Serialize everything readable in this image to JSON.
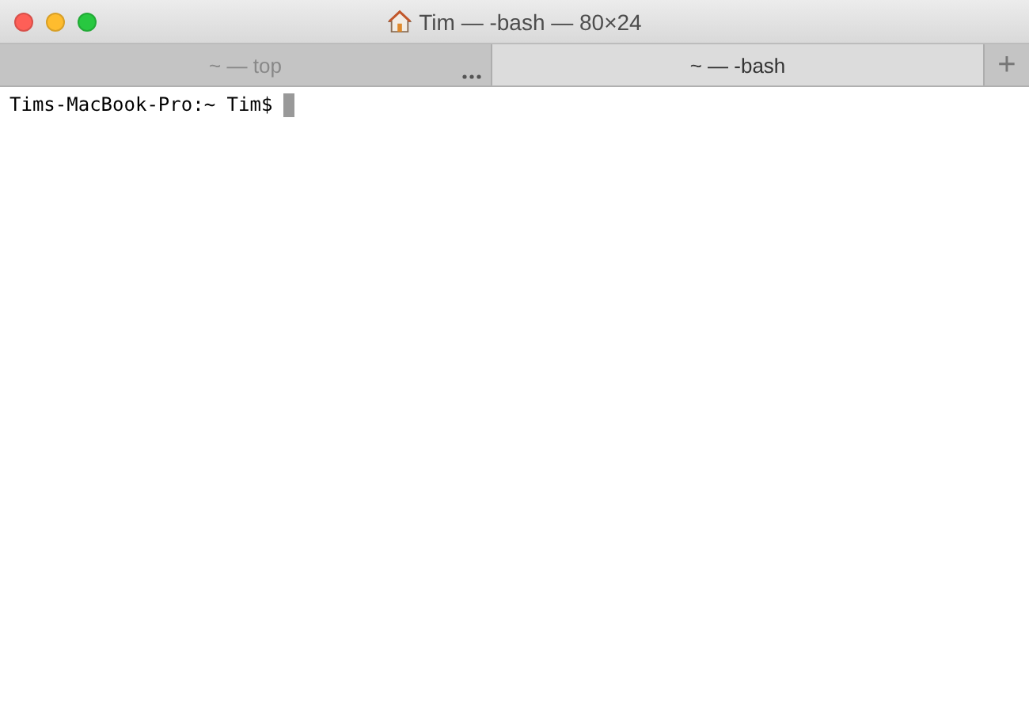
{
  "window": {
    "title": "Tim — -bash — 80×24"
  },
  "tabs": [
    {
      "label": "~ — top",
      "selected": false,
      "busy": true
    },
    {
      "label": "~ — -bash",
      "selected": true,
      "busy": false
    }
  ],
  "new_tab_button": "+",
  "terminal": {
    "lines": [
      "Tims-MacBook-Pro:~ Tim$ "
    ],
    "cursor": true
  }
}
